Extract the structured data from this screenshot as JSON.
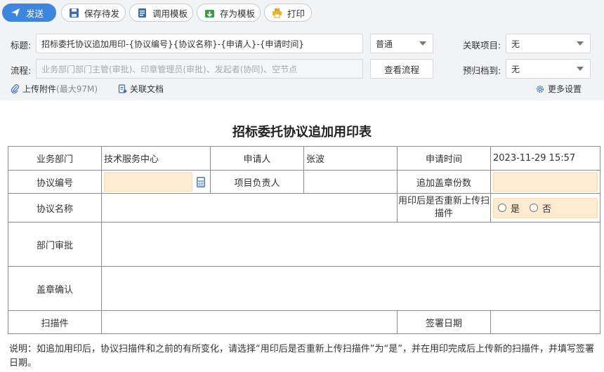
{
  "toolbar": {
    "send": "发送",
    "save_draft": "保存待发",
    "use_template": "调用模板",
    "save_template": "存为模板",
    "print": "打印"
  },
  "header": {
    "title_label": "标题:",
    "title_value": "招标委托协议追加用印-{协议编号}{协议名称}-{申请人}-{申请时间}",
    "priority": "普通",
    "project_label": "关联项目:",
    "project_value": "无",
    "flow_label": "流程:",
    "flow_placeholder": "业务部门部门主管(审批)、印章管理员(审批)、发起者(协同)、空节点",
    "view_flow": "查看流程",
    "archive_label": "预归档到:",
    "archive_value": "无",
    "upload": "上传附件",
    "upload_limit": "(最大97M)",
    "related_docs": "关联文档",
    "more_settings": "更多设置"
  },
  "form": {
    "title": "招标委托协议追加用印表",
    "dept_label": "业务部门",
    "dept_value": "技术服务中心",
    "applicant_label": "申请人",
    "applicant_value": "张波",
    "apply_time_label": "申请时间",
    "apply_time_value": "2023-11-29 15:57",
    "agreement_no_label": "协议编号",
    "project_lead_label": "项目负责人",
    "extra_copies_label": "追加盖章份数",
    "agreement_name_label": "协议名称",
    "reupload_label": "用印后是否重新上传扫描件",
    "yes": "是",
    "no": "否",
    "dept_approval_label": "部门审批",
    "seal_confirm_label": "盖章确认",
    "scan_label": "扫描件",
    "sign_date_label": "签署日期"
  },
  "note": "说明：如追加用印后，协议扫描件和之前的有所变化，请选择“用印后是否重新上传扫描件”为“是”，并在用印完成后上传新的扫描件，并填写签署日期。",
  "colors": {
    "primary": "#3d86e0",
    "toolbar_bg": "#f2f3f5",
    "fill": "#fdebd0"
  }
}
